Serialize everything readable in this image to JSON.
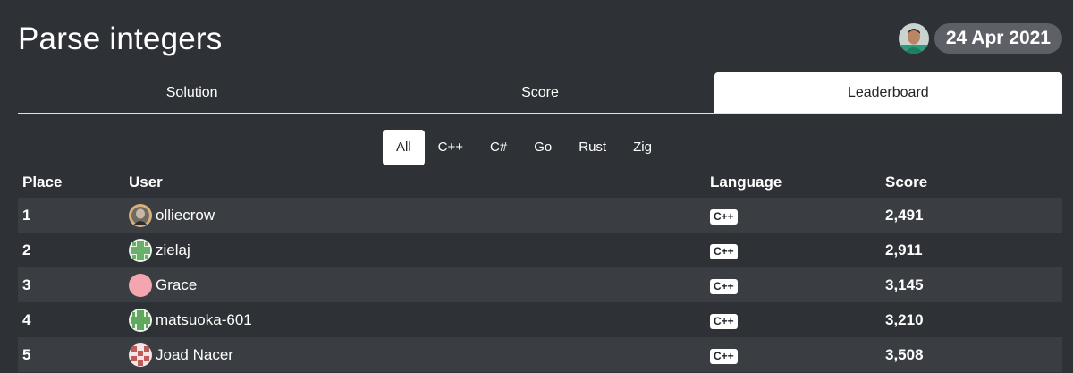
{
  "page": {
    "title": "Parse integers",
    "date": "24 Apr 2021"
  },
  "tabs": [
    {
      "label": "Solution",
      "active": false
    },
    {
      "label": "Score",
      "active": false
    },
    {
      "label": "Leaderboard",
      "active": true
    }
  ],
  "language_filter": [
    {
      "label": "All",
      "active": true
    },
    {
      "label": "C++",
      "active": false
    },
    {
      "label": "C#",
      "active": false
    },
    {
      "label": "Go",
      "active": false
    },
    {
      "label": "Rust",
      "active": false
    },
    {
      "label": "Zig",
      "active": false
    }
  ],
  "leaderboard": {
    "headers": {
      "place": "Place",
      "user": "User",
      "language": "Language",
      "score": "Score"
    },
    "rows": [
      {
        "place": "1",
        "user": "olliecrow",
        "avatar": "photo-avatar-icon",
        "language": "C++",
        "score": "2,491"
      },
      {
        "place": "2",
        "user": "zielaj",
        "avatar": "green-identicon-avatar-icon",
        "language": "C++",
        "score": "2,911"
      },
      {
        "place": "3",
        "user": "Grace",
        "avatar": "pink-circle-avatar-icon",
        "language": "C++",
        "score": "3,145"
      },
      {
        "place": "4",
        "user": "matsuoka-601",
        "avatar": "green-identicon-avatar-icon",
        "language": "C++",
        "score": "3,210"
      },
      {
        "place": "5",
        "user": "Joad Nacer",
        "avatar": "red-identicon-avatar-icon",
        "language": "C++",
        "score": "3,508"
      }
    ]
  },
  "colors": {
    "background": "#2e3135",
    "row_stripe": "#3a3e43",
    "date_pill": "#5d6167",
    "active_tab": "#ffffff"
  }
}
